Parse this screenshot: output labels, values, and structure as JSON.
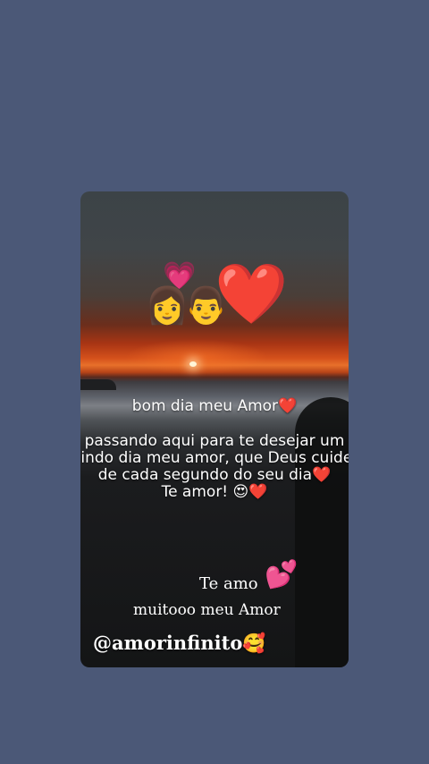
{
  "colors": {
    "background": "#4b5877",
    "text": "#ffffff"
  },
  "overlay": {
    "emoji_heart_pink": "💗",
    "emoji_couple": "👩👨",
    "emoji_big_heart": "❤️"
  },
  "caption": {
    "greeting": "bom dia meu Amor❤️",
    "message": "passando aqui para te desejar um\nlindo dia meu amor, que Deus cuide\nde cada segundo do seu dia❤️\nTe amor! 😍❤️"
  },
  "footer": {
    "te_amo": "Te amo",
    "kiss_heart": "💕",
    "muitooo": "muitooo meu Amor",
    "handle": "@amorinfinito🥰"
  }
}
